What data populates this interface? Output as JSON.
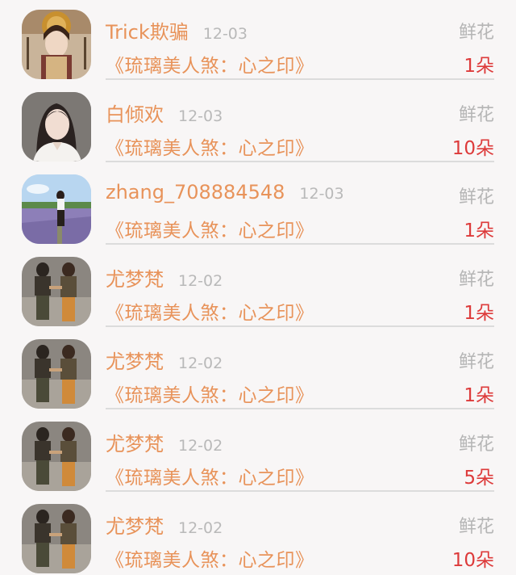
{
  "items": [
    {
      "username": "Trick欺骗",
      "date": "12-03",
      "gift_type": "鲜花",
      "book_title": "《琉璃美人煞：心之印》",
      "amount": "1朵",
      "avatar": "avatar-costume"
    },
    {
      "username": "白倾欢",
      "date": "12-03",
      "gift_type": "鲜花",
      "book_title": "《琉璃美人煞：心之印》",
      "amount": "10朵",
      "avatar": "avatar-portrait"
    },
    {
      "username": "zhang_708884548",
      "date": "12-03",
      "gift_type": "鲜花",
      "book_title": "《琉璃美人煞：心之印》",
      "amount": "1朵",
      "avatar": "avatar-field"
    },
    {
      "username": "尤梦梵",
      "date": "12-02",
      "gift_type": "鲜花",
      "book_title": "《琉璃美人煞：心之印》",
      "amount": "1朵",
      "avatar": "avatar-couple"
    },
    {
      "username": "尤梦梵",
      "date": "12-02",
      "gift_type": "鲜花",
      "book_title": "《琉璃美人煞：心之印》",
      "amount": "1朵",
      "avatar": "avatar-couple"
    },
    {
      "username": "尤梦梵",
      "date": "12-02",
      "gift_type": "鲜花",
      "book_title": "《琉璃美人煞：心之印》",
      "amount": "5朵",
      "avatar": "avatar-couple"
    },
    {
      "username": "尤梦梵",
      "date": "12-02",
      "gift_type": "鲜花",
      "book_title": "《琉璃美人煞：心之印》",
      "amount": "10朵",
      "avatar": "avatar-couple"
    }
  ],
  "colors": {
    "username": "#e8935a",
    "amount": "#dd3a3a",
    "muted": "#b9b9b9"
  }
}
